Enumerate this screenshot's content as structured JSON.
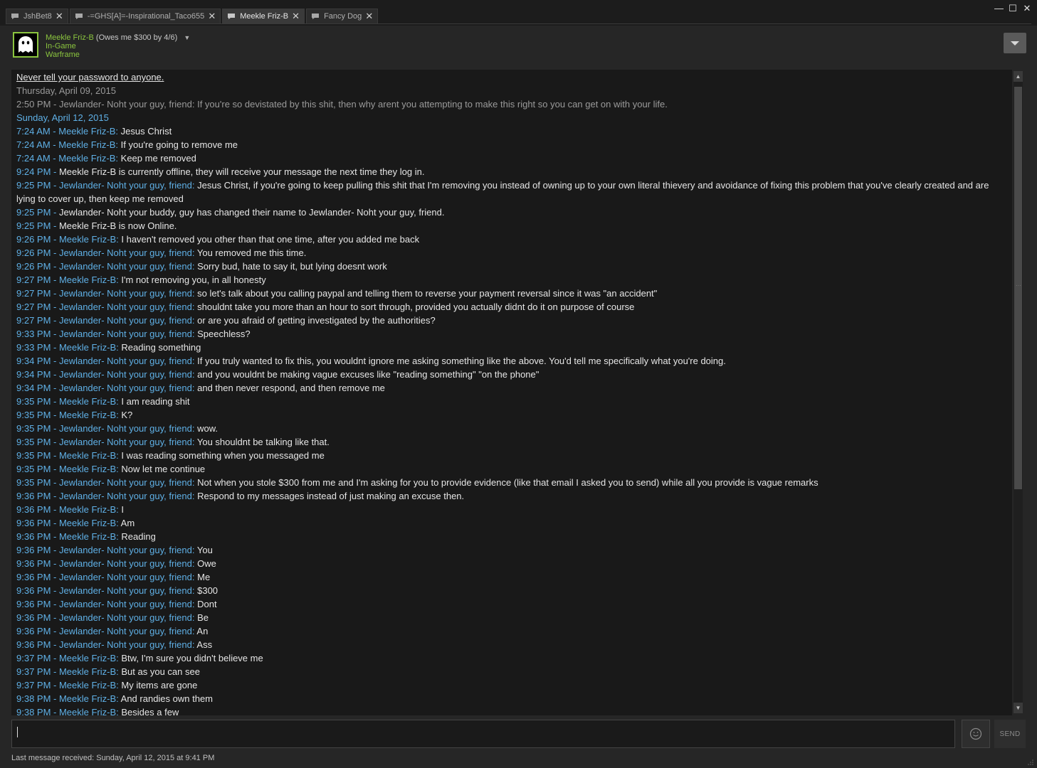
{
  "tabs": [
    {
      "label": "JshBet8",
      "active": false
    },
    {
      "label": "-=GHS[A]=-Inspirational_Taco655",
      "active": false
    },
    {
      "label": "Meekle Friz-B",
      "active": true
    },
    {
      "label": "Fancy Dog",
      "active": false
    }
  ],
  "window_controls": {
    "minimize": "—",
    "maximize": "☐",
    "close": "✕"
  },
  "header": {
    "name": "Meekle Friz-B",
    "nickname": "(Owes me $300 by 4/6)",
    "status": "In-Game",
    "game": "Warframe"
  },
  "chat": {
    "warning": "Never tell your password to anyone.",
    "date1": "Thursday, April 09, 2015",
    "old_message": "2:50 PM - Jewlander- Noht your guy, friend: If you're so devistated by this shit, then why arent you attempting to make this right so you can get on with your life.",
    "date2": "Sunday, April 12, 2015",
    "messages": [
      {
        "meta": "7:24 AM - Meekle Friz-B:",
        "text": " Jesus Christ"
      },
      {
        "meta": "7:24 AM - Meekle Friz-B:",
        "text": " If you're going to remove me"
      },
      {
        "meta": "7:24 AM - Meekle Friz-B:",
        "text": " Keep me removed"
      },
      {
        "meta": "9:24 PM -",
        "text": " Meekle Friz-B is currently offline, they will receive your message the next time they log in."
      },
      {
        "meta": "9:25 PM - Jewlander- Noht your guy, friend:",
        "text": " Jesus Christ, if you're going to keep pulling this shit that I'm removing you instead of owning up to your own literal thievery and avoidance of fixing this problem that you've clearly created and are lying to cover up, then keep me removed"
      },
      {
        "meta": "9:25 PM -",
        "text": " Jewlander- Noht your buddy, guy has changed their name to Jewlander- Noht your guy, friend."
      },
      {
        "meta": "9:25 PM -",
        "text": " Meekle Friz-B is now Online."
      },
      {
        "meta": "9:26 PM - Meekle Friz-B:",
        "text": " I haven't removed you other than that one time, after you added me back"
      },
      {
        "meta": "9:26 PM - Jewlander- Noht your guy, friend:",
        "text": " You removed me this time."
      },
      {
        "meta": "9:26 PM - Jewlander- Noht your guy, friend:",
        "text": " Sorry bud, hate to say it, but lying doesnt work"
      },
      {
        "meta": "9:27 PM - Meekle Friz-B:",
        "text": " I'm not removing you, in all honesty"
      },
      {
        "meta": "9:27 PM - Jewlander- Noht your guy, friend:",
        "text": " so let's talk about you calling paypal and telling them to reverse your payment reversal since it was \"an accident\""
      },
      {
        "meta": "9:27 PM - Jewlander- Noht your guy, friend:",
        "text": " shouldnt take you more than an hour to sort through, provided you actually didnt do it on purpose of course"
      },
      {
        "meta": "9:27 PM - Jewlander- Noht your guy, friend:",
        "text": " or are you afraid of getting investigated by the authorities?"
      },
      {
        "meta": "9:33 PM - Jewlander- Noht your guy, friend:",
        "text": " Speechless?"
      },
      {
        "meta": "9:33 PM - Meekle Friz-B:",
        "text": " Reading something"
      },
      {
        "meta": "9:34 PM - Jewlander- Noht your guy, friend:",
        "text": " If you truly wanted to fix this, you wouldnt ignore me asking something like the above. You'd tell me specifically what you're doing."
      },
      {
        "meta": "9:34 PM - Jewlander- Noht your guy, friend:",
        "text": " and you wouldnt be making vague excuses like \"reading something\" \"on the phone\""
      },
      {
        "meta": "9:34 PM - Jewlander- Noht your guy, friend:",
        "text": " and then never respond, and then remove me"
      },
      {
        "meta": "9:35 PM - Meekle Friz-B:",
        "text": " I am reading shit"
      },
      {
        "meta": "9:35 PM - Meekle Friz-B:",
        "text": " K?"
      },
      {
        "meta": "9:35 PM - Jewlander- Noht your guy, friend:",
        "text": " wow."
      },
      {
        "meta": "9:35 PM - Jewlander- Noht your guy, friend:",
        "text": " You shouldnt be talking like that."
      },
      {
        "meta": "9:35 PM - Meekle Friz-B:",
        "text": " I was reading something when you messaged me"
      },
      {
        "meta": "9:35 PM - Meekle Friz-B:",
        "text": " Now let me continue"
      },
      {
        "meta": "9:35 PM - Jewlander- Noht your guy, friend:",
        "text": " Not when you stole $300 from me and I'm asking for you to provide evidence (like that email I asked you to send) while all you provide is vague remarks"
      },
      {
        "meta": "9:36 PM - Jewlander- Noht your guy, friend:",
        "text": " Respond to my messages instead of just making an excuse then."
      },
      {
        "meta": "9:36 PM - Meekle Friz-B:",
        "text": " I"
      },
      {
        "meta": "9:36 PM - Meekle Friz-B:",
        "text": " Am"
      },
      {
        "meta": "9:36 PM - Meekle Friz-B:",
        "text": " Reading"
      },
      {
        "meta": "9:36 PM - Jewlander- Noht your guy, friend:",
        "text": " You"
      },
      {
        "meta": "9:36 PM - Jewlander- Noht your guy, friend:",
        "text": " Owe"
      },
      {
        "meta": "9:36 PM - Jewlander- Noht your guy, friend:",
        "text": " Me"
      },
      {
        "meta": "9:36 PM - Jewlander- Noht your guy, friend:",
        "text": " $300"
      },
      {
        "meta": "9:36 PM - Jewlander- Noht your guy, friend:",
        "text": " Dont"
      },
      {
        "meta": "9:36 PM - Jewlander- Noht your guy, friend:",
        "text": " Be"
      },
      {
        "meta": "9:36 PM - Jewlander- Noht your guy, friend:",
        "text": " An"
      },
      {
        "meta": "9:36 PM - Jewlander- Noht your guy, friend:",
        "text": " Ass"
      },
      {
        "meta": "9:37 PM - Meekle Friz-B:",
        "text": " Btw, I'm sure you didn't believe me"
      },
      {
        "meta": "9:37 PM - Meekle Friz-B:",
        "text": " But as you can see"
      },
      {
        "meta": "9:37 PM - Meekle Friz-B:",
        "text": " My items are gone"
      },
      {
        "meta": "9:38 PM - Meekle Friz-B:",
        "text": " And randies own them"
      },
      {
        "meta": "9:38 PM - Meekle Friz-B:",
        "text": " Besides a few"
      }
    ]
  },
  "composer": {
    "send_label": "SEND"
  },
  "footer": {
    "last_message": "Last message received: Sunday, April 12, 2015 at 9:41 PM"
  },
  "colors": {
    "accent_green": "#8bc53f",
    "meta_blue": "#5fb0e6",
    "background": "#262626"
  }
}
